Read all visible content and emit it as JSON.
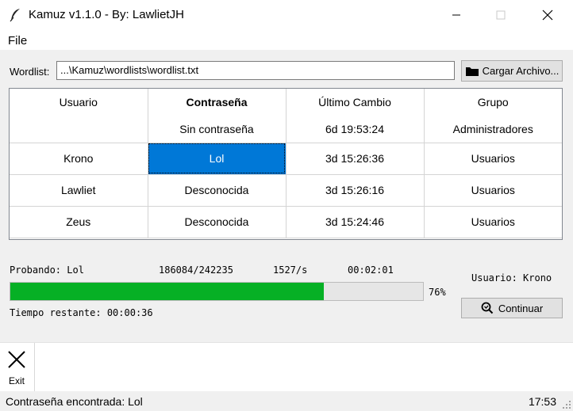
{
  "window": {
    "title": "Kamuz v1.1.0 - By: LawlietJH",
    "icons": [
      "feather-icon",
      "minimize-icon",
      "maximize-icon",
      "close-icon"
    ]
  },
  "menu": {
    "file_label": "File"
  },
  "wordlist": {
    "label": "Wordlist:",
    "value": "...\\Kamuz\\wordlists\\wordlist.txt",
    "load_button": "Cargar Archivo...",
    "load_icon": "folder-icon"
  },
  "table": {
    "headers": [
      "Usuario",
      "Contraseña",
      "Último Cambio",
      "Grupo"
    ],
    "rows": [
      [
        "",
        "Sin contraseña",
        "6d 19:53:24",
        "Administradores"
      ],
      [
        "Krono",
        "Lol",
        "3d 15:26:36",
        "Usuarios"
      ],
      [
        "Lawliet",
        "Desconocida",
        "3d 15:26:16",
        "Usuarios"
      ],
      [
        "Zeus",
        "Desconocida",
        "3d 15:24:46",
        "Usuarios"
      ]
    ],
    "selection_color": "#0078d7"
  },
  "progress": {
    "testing": "Probando: Lol",
    "count": "186084/242235",
    "rate": "1527/s",
    "elapsed": "00:02:01",
    "percent_label": "76%",
    "fraction": 0.76,
    "fill_color": "#06b025",
    "remaining": "Tiempo restante: 00:00:36"
  },
  "side": {
    "user_label": "Usuario:  Krono",
    "continue_button": "Continuar",
    "continue_icon": "search-icon"
  },
  "toolbar": {
    "exit_label": "Exit",
    "exit_icon": "close-x-icon"
  },
  "status": {
    "message": "Contraseña encontrada: Lol",
    "time": "17:53"
  }
}
